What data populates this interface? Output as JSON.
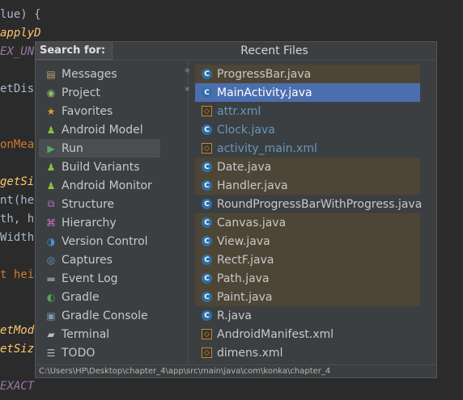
{
  "editor": {
    "lines": [
      {
        "text": "lue) {",
        "cls": ""
      },
      {
        "text": "applyDimension(",
        "cls": "italic"
      },
      {
        "text": "EX_UN",
        "cls": "purple"
      },
      {
        "text": "",
        "cls": ""
      },
      {
        "text": "etDis",
        "cls": ""
      },
      {
        "text": "",
        "cls": ""
      },
      {
        "text": "",
        "cls": ""
      },
      {
        "text": "onMea",
        "cls": "orange"
      },
      {
        "text": "",
        "cls": ""
      },
      {
        "text": "getSi",
        "cls": "italic"
      },
      {
        "text": "nt(he",
        "cls": ""
      },
      {
        "text": "th, h",
        "cls": ""
      },
      {
        "text": "Width",
        "cls": ""
      },
      {
        "text": "",
        "cls": ""
      },
      {
        "text": "t hei",
        "cls": "orange"
      },
      {
        "text": "",
        "cls": ""
      },
      {
        "text": "",
        "cls": ""
      },
      {
        "text": "etMod",
        "cls": "italic"
      },
      {
        "text": "etSiz",
        "cls": "italic"
      },
      {
        "text": "",
        "cls": ""
      },
      {
        "text": "EXACT",
        "cls": "purple"
      }
    ]
  },
  "popup": {
    "search_label": "Search for:",
    "title": "Recent Files",
    "path": "C:\\Users\\HP\\Desktop\\chapter_4\\app\\src\\main\\java\\com\\konka\\chapter_4"
  },
  "tool_windows": [
    {
      "label": "Messages",
      "icon": "messages-icon",
      "glyph": "▤",
      "color": "#c8a06a",
      "selected": false
    },
    {
      "label": "Project",
      "icon": "project-icon",
      "glyph": "◉",
      "color": "#8fbf6a",
      "selected": false
    },
    {
      "label": "Favorites",
      "icon": "star-icon",
      "glyph": "★",
      "color": "#e0a030",
      "selected": false
    },
    {
      "label": "Android Model",
      "icon": "android-icon",
      "glyph": "♟",
      "color": "#8fbf3a",
      "selected": false
    },
    {
      "label": "Run",
      "icon": "run-icon",
      "glyph": "▶",
      "color": "#59a869",
      "selected": true
    },
    {
      "label": "Build Variants",
      "icon": "android-icon",
      "glyph": "♟",
      "color": "#8fbf3a",
      "selected": false
    },
    {
      "label": "Android Monitor",
      "icon": "android-icon",
      "glyph": "♟",
      "color": "#8fbf3a",
      "selected": false
    },
    {
      "label": "Structure",
      "icon": "structure-icon",
      "glyph": "⧉",
      "color": "#c070c0",
      "selected": false
    },
    {
      "label": "Hierarchy",
      "icon": "hierarchy-icon",
      "glyph": "⌘",
      "color": "#d070d0",
      "selected": false
    },
    {
      "label": "Version Control",
      "icon": "version-control-icon",
      "glyph": "◑",
      "color": "#4a90d0",
      "selected": false
    },
    {
      "label": "Captures",
      "icon": "captures-icon",
      "glyph": "◎",
      "color": "#6a9fc8",
      "selected": false
    },
    {
      "label": "Event Log",
      "icon": "event-log-icon",
      "glyph": "▬",
      "color": "#8a8a8a",
      "selected": false
    },
    {
      "label": "Gradle",
      "icon": "gradle-icon",
      "glyph": "◐",
      "color": "#5aa05a",
      "selected": false
    },
    {
      "label": "Gradle Console",
      "icon": "gradle-console-icon",
      "glyph": "▣",
      "color": "#7a9ab5",
      "selected": false
    },
    {
      "label": "Terminal",
      "icon": "terminal-icon",
      "glyph": "▰",
      "color": "#bbbbbb",
      "selected": false
    },
    {
      "label": "TODO",
      "icon": "todo-icon",
      "glyph": "☰",
      "color": "#bbbbbb",
      "selected": false
    }
  ],
  "recent_files": [
    {
      "name": "ProgressBar.java",
      "type": "class",
      "modified": true,
      "starred": true,
      "blue": false,
      "selected": false
    },
    {
      "name": "MainActivity.java",
      "type": "class",
      "modified": false,
      "starred": true,
      "blue": false,
      "selected": true
    },
    {
      "name": "attr.xml",
      "type": "xml",
      "modified": false,
      "starred": false,
      "blue": true,
      "selected": false
    },
    {
      "name": "Clock.java",
      "type": "class",
      "modified": false,
      "starred": false,
      "blue": true,
      "selected": false
    },
    {
      "name": "activity_main.xml",
      "type": "xml",
      "modified": false,
      "starred": false,
      "blue": true,
      "selected": false
    },
    {
      "name": "Date.java",
      "type": "class",
      "modified": true,
      "starred": false,
      "blue": false,
      "selected": false
    },
    {
      "name": "Handler.java",
      "type": "class",
      "modified": true,
      "starred": false,
      "blue": false,
      "selected": false
    },
    {
      "name": "RoundProgressBarWithProgress.java",
      "type": "class",
      "modified": false,
      "starred": false,
      "blue": false,
      "selected": false
    },
    {
      "name": "Canvas.java",
      "type": "class",
      "modified": true,
      "starred": false,
      "blue": false,
      "selected": false
    },
    {
      "name": "View.java",
      "type": "class",
      "modified": true,
      "starred": false,
      "blue": false,
      "selected": false
    },
    {
      "name": "RectF.java",
      "type": "class",
      "modified": true,
      "starred": false,
      "blue": false,
      "selected": false
    },
    {
      "name": "Path.java",
      "type": "class",
      "modified": true,
      "starred": false,
      "blue": false,
      "selected": false
    },
    {
      "name": "Paint.java",
      "type": "class",
      "modified": true,
      "starred": false,
      "blue": false,
      "selected": false
    },
    {
      "name": "R.java",
      "type": "class",
      "modified": false,
      "starred": false,
      "blue": false,
      "selected": false
    },
    {
      "name": "AndroidManifest.xml",
      "type": "manifest",
      "modified": false,
      "starred": false,
      "blue": false,
      "selected": false
    },
    {
      "name": "dimens.xml",
      "type": "xml",
      "modified": false,
      "starred": false,
      "blue": false,
      "selected": false
    }
  ],
  "star_glyph": "*"
}
